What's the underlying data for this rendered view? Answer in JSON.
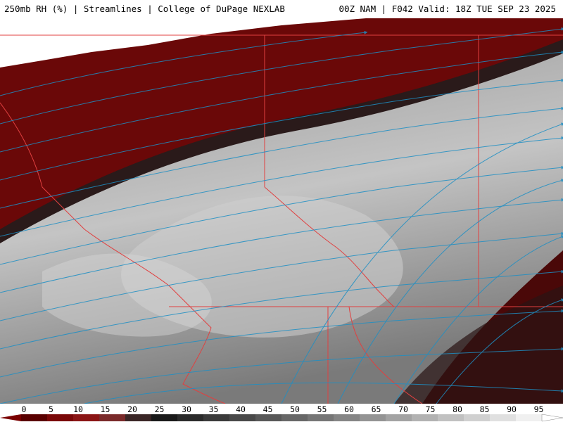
{
  "header": {
    "left_title": "250mb RH (%) | Streamlines | College of DuPage NEXLAB",
    "right_title": "00Z NAM | F042 Valid: 18Z TUE SEP 23 2025"
  },
  "colorbar": {
    "labels": [
      "0",
      "5",
      "10",
      "15",
      "20",
      "25",
      "30",
      "35",
      "40",
      "45",
      "50",
      "55",
      "60",
      "65",
      "70",
      "75",
      "80",
      "85",
      "90",
      "95"
    ],
    "stops": [
      "#5a0000",
      "#7a0808",
      "#8b1515",
      "#7a2a2a",
      "#3a2626",
      "#1a1a1a",
      "#2b2b2b",
      "#3a3a3a",
      "#494949",
      "#585858",
      "#676767",
      "#767676",
      "#858585",
      "#949494",
      "#a3a3a3",
      "#b2b2b2",
      "#c1c1c1",
      "#d0d0d0",
      "#e0e0e0",
      "#f0f0f0"
    ]
  },
  "colors": {
    "streamline": "#1e8fc4",
    "border": "#e04040"
  }
}
